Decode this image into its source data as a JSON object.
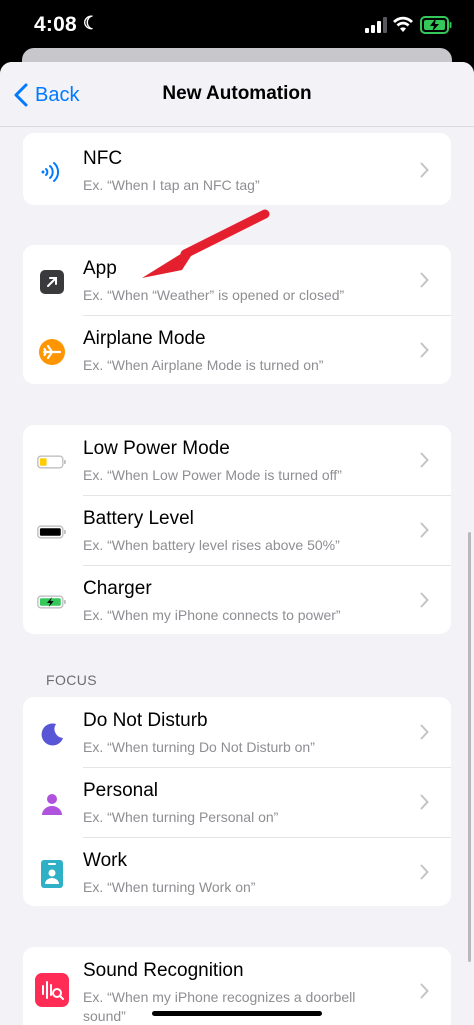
{
  "status_bar": {
    "time": "4:08"
  },
  "nav": {
    "back_label": "Back",
    "title": "New Automation"
  },
  "groups": [
    {
      "items": [
        {
          "title": "NFC",
          "subtitle": "Ex. “When I tap an NFC tag”",
          "icon": "nfc-icon"
        }
      ]
    },
    {
      "items": [
        {
          "title": "App",
          "subtitle": "Ex. “When “Weather” is opened or closed”",
          "icon": "app-icon"
        },
        {
          "title": "Airplane Mode",
          "subtitle": "Ex. “When Airplane Mode is turned on”",
          "icon": "airplane-icon"
        }
      ]
    },
    {
      "items": [
        {
          "title": "Low Power Mode",
          "subtitle": "Ex. “When Low Power Mode is turned off”",
          "icon": "low-battery-icon"
        },
        {
          "title": "Battery Level",
          "subtitle": "Ex. “When battery level rises above 50%”",
          "icon": "battery-icon"
        },
        {
          "title": "Charger",
          "subtitle": "Ex. “When my iPhone connects to power”",
          "icon": "charging-battery-icon"
        }
      ]
    },
    {
      "header": "FOCUS",
      "items": [
        {
          "title": "Do Not Disturb",
          "subtitle": "Ex. “When turning Do Not Disturb on”",
          "icon": "moon-icon"
        },
        {
          "title": "Personal",
          "subtitle": "Ex. “When turning Personal on”",
          "icon": "person-icon"
        },
        {
          "title": "Work",
          "subtitle": "Ex. “When turning Work on”",
          "icon": "work-badge-icon"
        }
      ]
    },
    {
      "items": [
        {
          "title": "Sound Recognition",
          "subtitle": "Ex. “When my iPhone recognizes a doorbell sound”",
          "icon": "sound-recognition-icon"
        }
      ]
    }
  ],
  "colors": {
    "accent": "#007aff",
    "annotation_arrow": "#e5202e",
    "airplane": "#ff9500",
    "moon": "#5856d6",
    "personal": "#af52de",
    "work": "#30b0c7",
    "sound_recognition": "#ff2d55",
    "low_power": "#ffcc00",
    "charger": "#34c759"
  }
}
